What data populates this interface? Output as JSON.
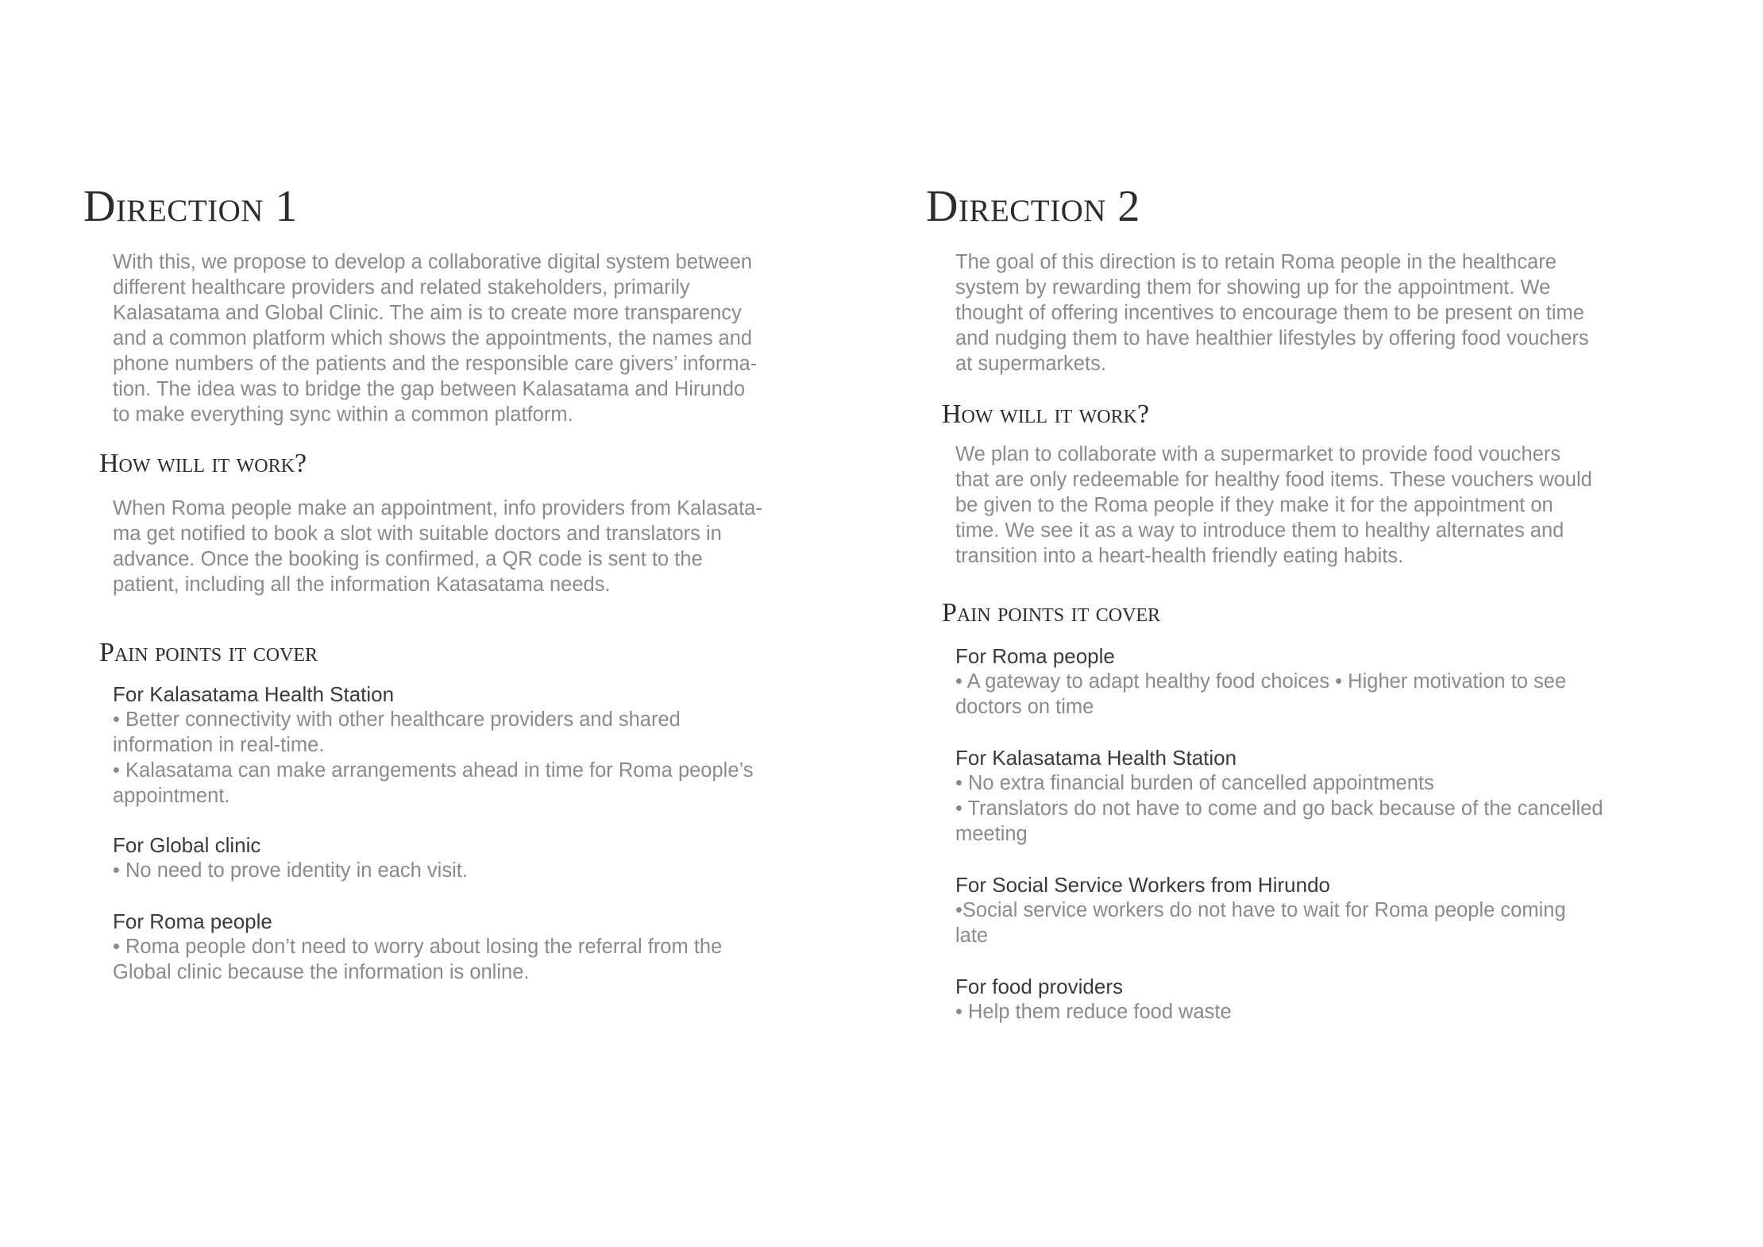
{
  "direction1": {
    "title": "Direction 1",
    "intro": "With this, we propose to develop a collaborative digital system between\ndifferent healthcare providers and related stakeholders, primarily\nKalasatama and Global Clinic. The aim is to create more transparency\nand a common platform which shows the appointments, the names and\nphone numbers of the patients and the responsible care givers’ informa-\ntion. The idea was to bridge the gap between Kalasatama and Hirundo\nto make everything sync within a common platform.",
    "how_heading": "How will it work?",
    "how_text": "When Roma people make an appointment, info providers from Kalasata-\nma get notified to book a slot with suitable doctors and translators in\nadvance. Once the booking is confirmed, a QR code is sent to the\npatient, including all the information Katasatama needs.",
    "pain_heading": "Pain points it cover",
    "groups": [
      {
        "title": "For Kalasatama Health Station",
        "lines": [
          "• Better connectivity with other healthcare providers and shared\ninformation in real-time.",
          "• Kalasatama can make arrangements ahead in time for Roma people’s\nappointment."
        ]
      },
      {
        "title": "For Global clinic",
        "lines": [
          "• No need to prove identity in each visit."
        ]
      },
      {
        "title": "For Roma people",
        "lines": [
          "• Roma people don’t need to worry about losing the referral from the\nGlobal clinic because the information is online."
        ]
      }
    ]
  },
  "direction2": {
    "title": "Direction 2",
    "intro": "The goal of this direction is to retain Roma people in the healthcare\nsystem by rewarding them for showing up for the appointment. We\nthought of offering incentives to encourage them to be present on time\nand nudging them to have healthier lifestyles by offering food vouchers\nat supermarkets.",
    "how_heading": "How will it work?",
    "how_text": "We plan to collaborate with a supermarket to provide food vouchers\nthat are only redeemable for healthy food items. These vouchers would\nbe given to the Roma people if they make it for the appointment on\ntime. We see it as a way to introduce them to healthy alternates and\ntransition into a heart-health friendly eating habits.",
    "pain_heading": "Pain points it cover",
    "groups": [
      {
        "title": "For Roma people",
        "lines": [
          "• A gateway to adapt healthy food choices • Higher motivation to see\ndoctors on time"
        ]
      },
      {
        "title": "For Kalasatama Health Station",
        "lines": [
          "• No extra financial burden of cancelled appointments",
          "• Translators do not have to come and go back because of the cancelled\nmeeting"
        ]
      },
      {
        "title": "For Social Service Workers from Hirundo",
        "lines": [
          "•Social service workers do not have to wait for Roma people coming\nlate"
        ]
      },
      {
        "title": "For food providers",
        "lines": [
          "• Help them reduce food waste"
        ]
      }
    ]
  }
}
